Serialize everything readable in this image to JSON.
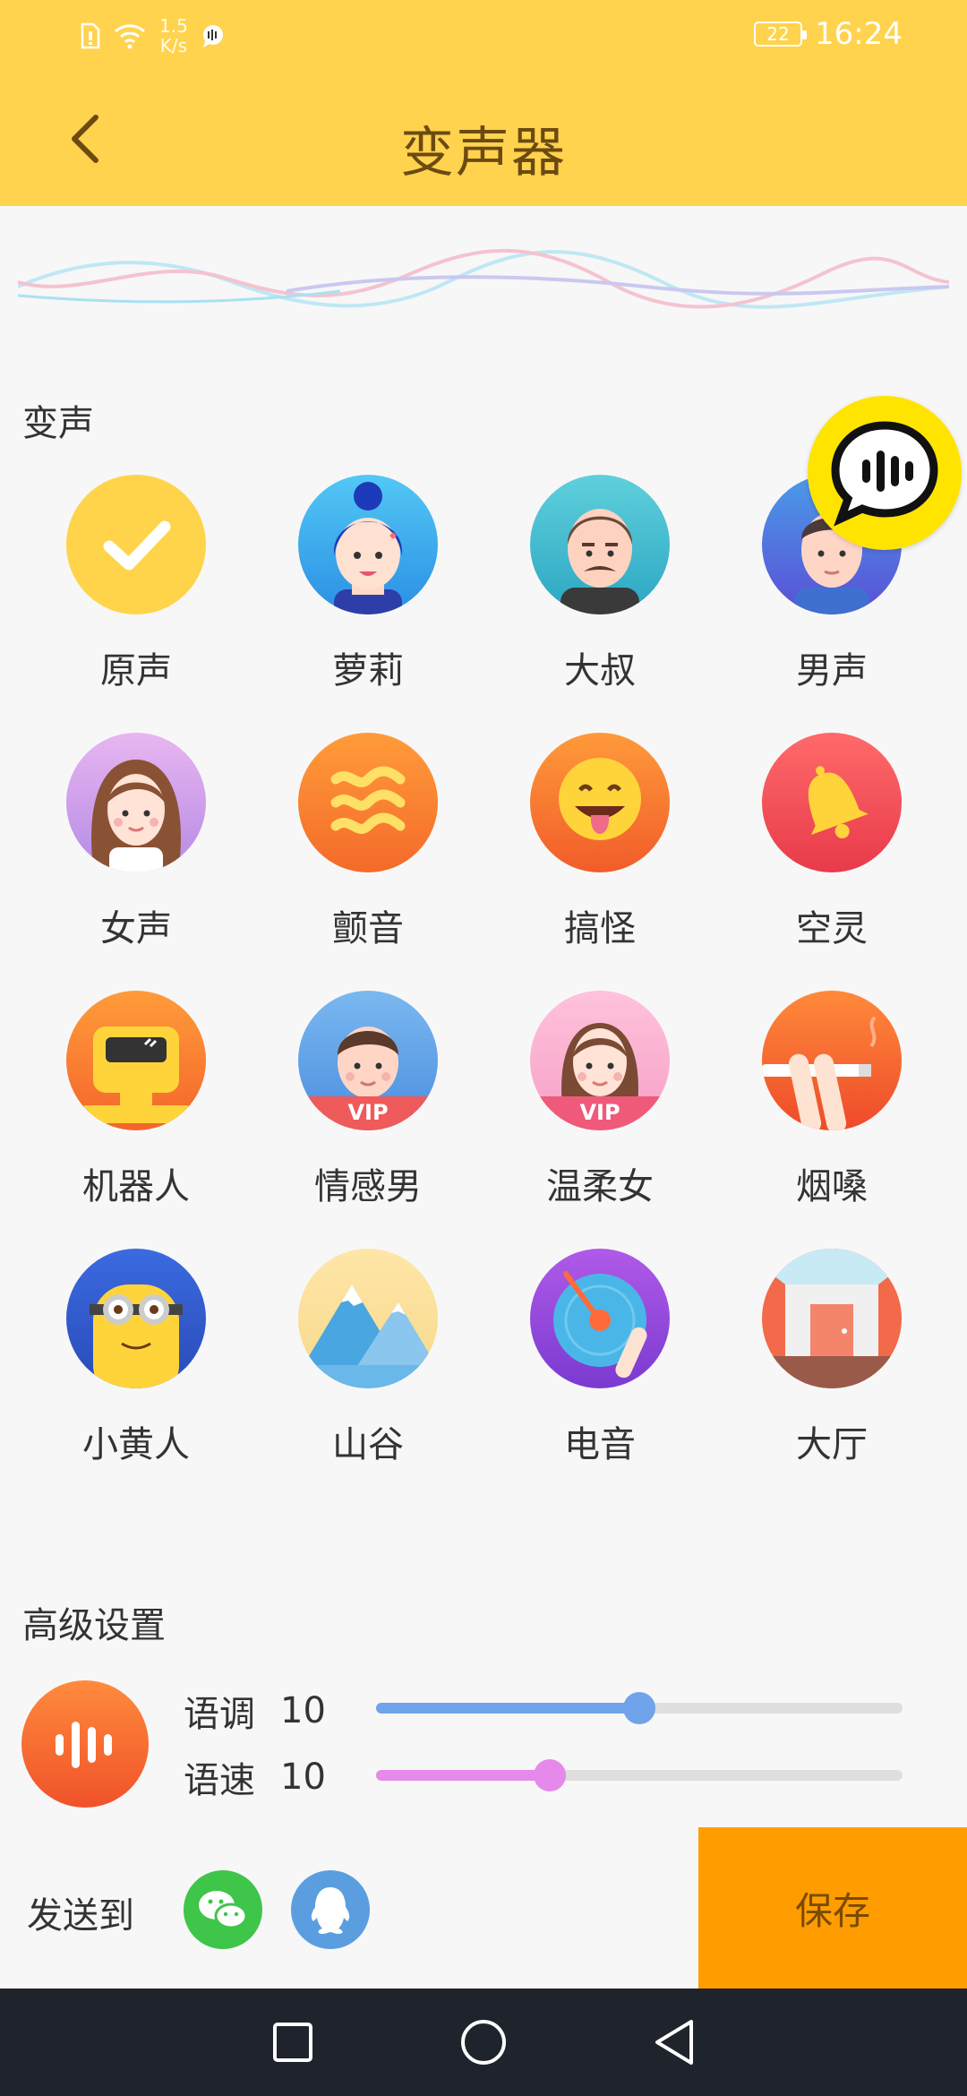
{
  "status_bar": {
    "net_speed": "1.5",
    "net_unit": "K/s",
    "battery": "22",
    "time": "16:24"
  },
  "header": {
    "title": "变声器"
  },
  "voice_section": {
    "label": "变声",
    "items": [
      {
        "label": "原声",
        "icon": "check-icon",
        "selected": true
      },
      {
        "label": "萝莉",
        "icon": "loli-girl-avatar"
      },
      {
        "label": "大叔",
        "icon": "uncle-avatar"
      },
      {
        "label": "男声",
        "icon": "male-avatar"
      },
      {
        "label": "女声",
        "icon": "female-avatar"
      },
      {
        "label": "颤音",
        "icon": "tremolo-wave-icon"
      },
      {
        "label": "搞怪",
        "icon": "tongue-emoji-icon"
      },
      {
        "label": "空灵",
        "icon": "bell-icon"
      },
      {
        "label": "机器人",
        "icon": "robot-icon"
      },
      {
        "label": "情感男",
        "icon": "vip-man-avatar",
        "badge": "VIP"
      },
      {
        "label": "温柔女",
        "icon": "vip-woman-avatar",
        "badge": "VIP"
      },
      {
        "label": "烟嗓",
        "icon": "cigarette-icon"
      },
      {
        "label": "小黄人",
        "icon": "minion-icon"
      },
      {
        "label": "山谷",
        "icon": "mountain-icon"
      },
      {
        "label": "电音",
        "icon": "vinyl-record-icon"
      },
      {
        "label": "大厅",
        "icon": "hall-icon"
      }
    ]
  },
  "advanced": {
    "label": "高级设置",
    "pitch": {
      "name": "语调",
      "value": "10",
      "level": 0.5
    },
    "speed": {
      "name": "语速",
      "value": "10",
      "level": 0.33
    }
  },
  "send": {
    "label": "发送到",
    "targets": [
      "wechat-icon",
      "qq-icon"
    ]
  },
  "save_label": "保存",
  "colors": {
    "accent": "#ffd34d",
    "save": "#ff9d00",
    "pitch": "#6fa3ea",
    "speed": "#e58aea"
  }
}
